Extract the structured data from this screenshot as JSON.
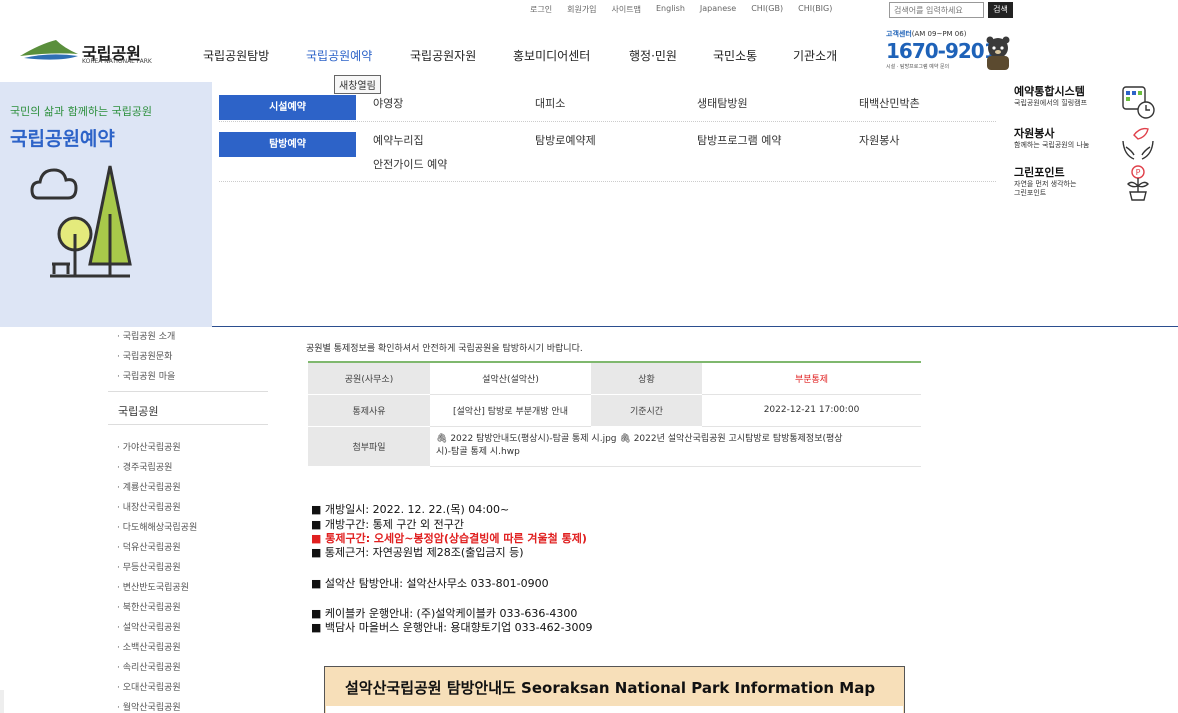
{
  "util_links": [
    "로그인",
    "회원가입",
    "사이트맵",
    "English",
    "Japanese",
    "CHI(GB)",
    "CHI(BIG)"
  ],
  "search": {
    "placeholder": "검색어를 입력하세요",
    "button": "검색"
  },
  "logo": {
    "title": "국립공원",
    "subtitle": "KOREA NATIONAL PARK"
  },
  "gnb": [
    "국립공원탐방",
    "국립공원예약",
    "국립공원자원",
    "홍보미디어센터",
    "행정·민원",
    "국민소통",
    "기관소개"
  ],
  "tooltip": "새창열림",
  "customer_center": {
    "title": "고객센터",
    "hours": "(AM 09~PM 06)",
    "phone": "1670-9201",
    "note": "시설 · 탐방프로그램 예약 문의"
  },
  "mega": {
    "sub": "국민의 삶과 함께하는 국립공원",
    "title": "국립공원예약",
    "cat1": "시설예약",
    "cat2": "탐방예약",
    "row1": [
      "야영장",
      "대피소",
      "생태탐방원",
      "태백산민박촌"
    ],
    "row2": [
      "예약누리집",
      "탐방로예약제",
      "탐방프로그램 예약",
      "자원봉사"
    ],
    "row3": [
      "안전가이드 예약"
    ],
    "side": [
      {
        "title": "예약통합시스템",
        "sub": "국립공원에서의 힐링캠프",
        "icon": "calendar-clock-icon"
      },
      {
        "title": "자원봉사",
        "sub": "함께하는 국립공원의 나눔",
        "icon": "hands-leaf-icon"
      },
      {
        "title": "그린포인트",
        "sub1": "자연을 먼저 생각하는",
        "sub2": "그린포인트",
        "icon": "plant-pot-icon"
      }
    ]
  },
  "sidebar": {
    "top_items": [
      "· 국립공원 소개",
      "· 국립공원문화",
      "· 국립공원 마을"
    ],
    "heading": "국립공원",
    "parks": [
      "· 가야산국립공원",
      "· 경주국립공원",
      "· 계룡산국립공원",
      "· 내장산국립공원",
      "· 다도해해상국립공원",
      "· 덕유산국립공원",
      "· 무등산국립공원",
      "· 변산반도국립공원",
      "· 북한산국립공원",
      "· 설악산국립공원",
      "· 소백산국립공원",
      "· 속리산국립공원",
      "· 오대산국립공원",
      "· 월악산국립공원"
    ]
  },
  "content": {
    "intro": "공원별 통제정보를 확인하셔서 안전하게 국립공원을 탐방하시기 바랍니다.",
    "table": {
      "park_label": "공원(사무소)",
      "park_value": "설악산(설악산)",
      "status_label": "상황",
      "status_value": "부분통제",
      "reason_label": "통제사유",
      "reason_value": "[설악산] 탐방로 부분개방 안내",
      "time_label": "기준시간",
      "time_value": "2022-12-21 17:00:00",
      "attach_label": "첨부파일",
      "attach_line1": "2022 탐방안내도(평상시)-탐골 통제 시.jpg",
      "attach_line1b": "2022년 설악산국립공원 고시탐방로 탐방통제정보(평상",
      "attach_line2": "시)-탐골 통제 시.hwp"
    },
    "notices": [
      "■ 개방일시: 2022. 12. 22.(목) 04:00~",
      "■ 개방구간: 통제 구간 외 전구간",
      "■ 통제구간: 오세암~봉정암(상습결빙에 따른 겨울철 통제)",
      "■ 통제근거: 자연공원법 제28조(출입금지 등)",
      "■ 설악산 탐방안내: 설악산사무소 033-801-0900",
      "■ 케이블카 운행안내: (주)설악케이블카 033-636-4300",
      "■ 백담사 마을버스 운행안내: 용대향토기업 033-462-3009"
    ],
    "map_title": "설악산국립공원 탐방안내도   Seoraksan National Park Information Map"
  }
}
